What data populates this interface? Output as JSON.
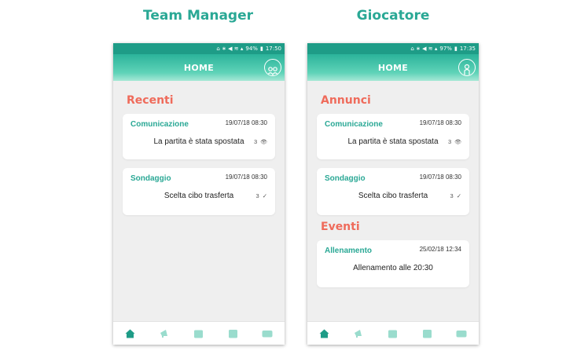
{
  "columns": [
    {
      "heading": "Team Manager"
    },
    {
      "heading": "Giocatore"
    }
  ],
  "left_phone": {
    "status": {
      "battery": "94%",
      "time": "17:50"
    },
    "appbar_title": "HOME",
    "sections": [
      {
        "title": "Recenti",
        "cards": [
          {
            "type": "Comunicazione",
            "date": "19/07/18 08:30",
            "text": "La partita è stata spostata",
            "count": "3",
            "icon": "eye-icon"
          },
          {
            "type": "Sondaggio",
            "date": "19/07/18 08:30",
            "text": "Scelta cibo trasferta",
            "count": "3",
            "icon": "check-icon"
          }
        ]
      }
    ]
  },
  "right_phone": {
    "status": {
      "battery": "97%",
      "time": "17:35"
    },
    "appbar_title": "HOME",
    "sections": [
      {
        "title": "Annunci",
        "cards": [
          {
            "type": "Comunicazione",
            "date": "19/07/18 08:30",
            "text": "La partita è stata spostata",
            "count": "3",
            "icon": "eye-icon"
          },
          {
            "type": "Sondaggio",
            "date": "19/07/18 08:30",
            "text": "Scelta cibo trasferta",
            "count": "3",
            "icon": "check-icon"
          }
        ]
      },
      {
        "title": "Eventi",
        "cards": [
          {
            "type": "Allenamento",
            "date": "25/02/18 12:34",
            "text": "Allenamento alle 20:30"
          }
        ]
      }
    ]
  },
  "icons": {
    "eye": "👁",
    "check": "✓"
  },
  "colors": {
    "accent": "#2aa895",
    "section_title": "#ef6b5b",
    "appbar_top": "#2bb39a",
    "statusbar": "#1e9c87",
    "nav_icon": "#9adccd",
    "nav_icon_active": "#1e9c87"
  }
}
